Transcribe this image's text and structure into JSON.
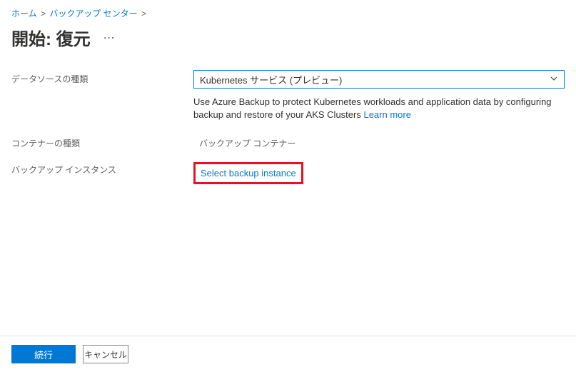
{
  "breadcrumb": {
    "home": "ホーム",
    "backup_center": "バックアップ センター"
  },
  "page_title": "開始: 復元",
  "form": {
    "datasource_type_label": "データソースの種類",
    "datasource_type_value": "Kubernetes サービス (プレビュー)",
    "help_text_prefix": "Use Azure Backup to protect Kubernetes workloads and application data by configuring backup and restore of your AKS Clusters ",
    "learn_more": "Learn more",
    "container_type_label": "コンテナーの種類",
    "container_type_value": "バックアップ コンテナー",
    "backup_instance_label": "バックアップ インスタンス",
    "select_backup_instance": "Select backup instance"
  },
  "footer": {
    "continue": "続行",
    "cancel": "キャンセル"
  }
}
